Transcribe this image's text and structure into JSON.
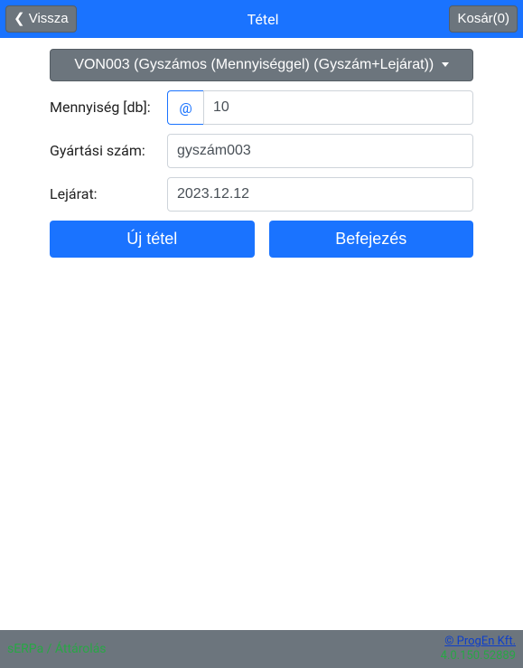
{
  "header": {
    "back_label": "❮ Vissza",
    "title": "Tétel",
    "cart_label": "Kosár(0)"
  },
  "form": {
    "product_select": "VON003 (Gyszámos (Mennyiséggel) (Gyszám+Lejárat))",
    "quantity_label": "Mennyiség [db]:",
    "quantity_addon": "@",
    "quantity_value": "10",
    "serial_label": "Gyártási szám:",
    "serial_value": "gyszám003",
    "expiry_label": "Lejárat:",
    "expiry_value": "2023.12.12"
  },
  "buttons": {
    "new_item": "Új tétel",
    "finish": "Befejezés"
  },
  "footer": {
    "left": "sERPa / Áttárolás",
    "company": "© ProgEn Kft.",
    "version": "4.0.150.52889"
  }
}
